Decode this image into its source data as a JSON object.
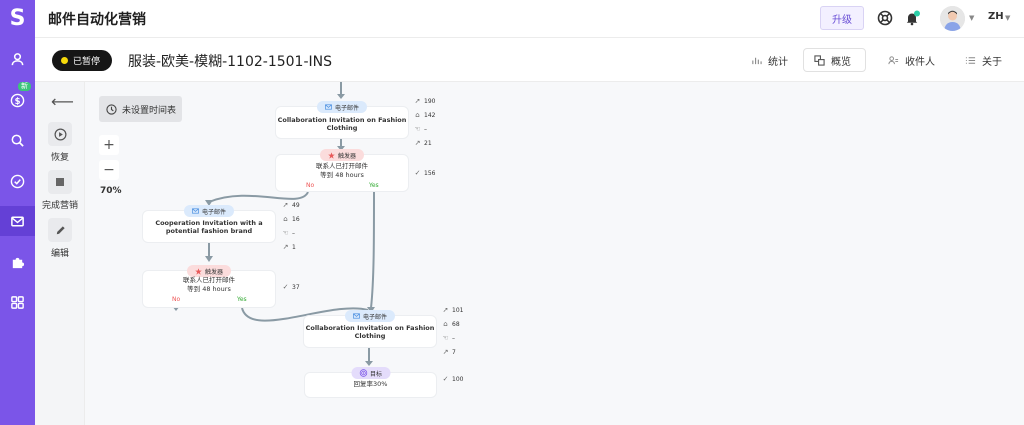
{
  "app": {
    "title": "邮件自动化营销",
    "logo": "S",
    "brand_color": "#7b55e8"
  },
  "rail": {
    "items": [
      {
        "icon": "user-icon"
      },
      {
        "icon": "dollar-icon",
        "badge": "新"
      },
      {
        "icon": "search-icon"
      },
      {
        "icon": "check-circle-icon"
      },
      {
        "icon": "mail-icon",
        "active": true
      },
      {
        "icon": "puzzle-icon"
      },
      {
        "icon": "grid-icon"
      }
    ]
  },
  "topbar": {
    "upgrade_label": "升级",
    "lang": "ZH"
  },
  "campaign": {
    "status": "已暂停",
    "name": "服装-欧美-模糊-1102-1501-INS",
    "actions": [
      {
        "label": "统计",
        "icon": "chart-icon"
      },
      {
        "label": "概览",
        "icon": "overview-icon",
        "active": true
      },
      {
        "label": "收件人",
        "icon": "recipients-icon"
      },
      {
        "label": "关于",
        "icon": "list-icon"
      }
    ]
  },
  "tools": {
    "resume": "恢复",
    "finish": "完成营销",
    "edit": "编辑"
  },
  "canvas": {
    "schedule_label": "未设置时间表",
    "zoom_in": "+",
    "zoom_out": "−",
    "zoom_level": "70%"
  },
  "flow": {
    "email1": {
      "chip": "电子邮件",
      "text": "Collaboration Invitation on Fashion Clothing",
      "stats": [
        "190",
        "142",
        "–",
        "21"
      ]
    },
    "trigger1": {
      "chip": "触发器",
      "line1": "联系人已打开邮件",
      "line2": "等到 48 hours",
      "no": "No",
      "yes": "Yes",
      "stat": "156"
    },
    "email2": {
      "chip": "电子邮件",
      "text": "Cooperation Invitation with a potential fashion brand",
      "stats": [
        "49",
        "16",
        "–",
        "1"
      ]
    },
    "trigger2": {
      "chip": "触发器",
      "line1": "联系人已打开邮件",
      "line2": "等到 48 hours",
      "no": "No",
      "yes": "Yes",
      "stat": "37"
    },
    "email3": {
      "chip": "电子邮件",
      "text": "Collaboration Invitation on Fashion Clothing",
      "stats": [
        "101",
        "68",
        "–",
        "7"
      ]
    },
    "goal": {
      "chip": "目标",
      "line1": "回复率30%",
      "stat": "100"
    }
  }
}
